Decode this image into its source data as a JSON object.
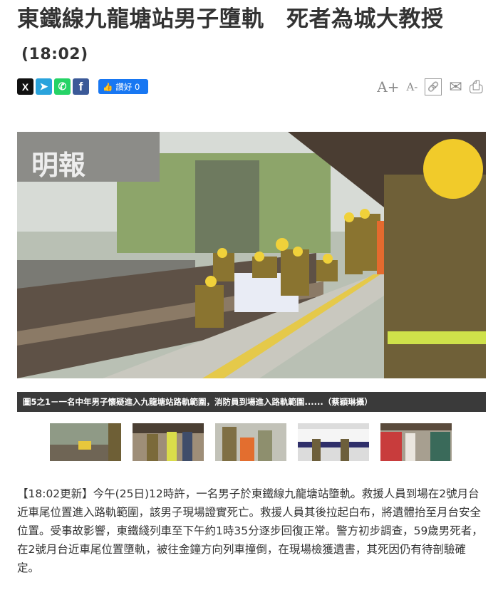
{
  "article": {
    "title": "東鐵線九龍塘站男子墮軌　死者為城大教授",
    "time": "(18:02)",
    "body": "【18:02更新】今午(25日)12時許，一名男子於東鐵線九龍塘站墮軌。救援人員到場在2號月台近車尾位置進入路軌範圍，該男子現場證實死亡。救援人員其後拉起白布，將遺體抬至月台安全位置。受事故影響，東鐵綫列車至下午約1時35分逐步回復正常。警方初步調查，59歲男死者，在2號月台近車尾位置墮軌，被往金鐘方向列車撞倒，在現場檢獲遺書，其死因仍有待剖驗確定。"
  },
  "share": {
    "x": "X",
    "telegram": "➤",
    "whatsapp": "✆",
    "facebook": "f",
    "like_label": "讚好 0"
  },
  "tools": {
    "font_up": "A+",
    "font_down": "A-",
    "link": "🔗",
    "mail": "✉",
    "print": "⎙"
  },
  "photo": {
    "watermark": "明報",
    "caption": "圖5之1－一名中年男子懷疑進入九龍塘站路軌範圍，消防員到場進入路軌範圍......（蔡穎琳攝）"
  },
  "colors": {
    "photo_caption_bg": "#3a3a3a",
    "like_button": "#1877f2"
  }
}
